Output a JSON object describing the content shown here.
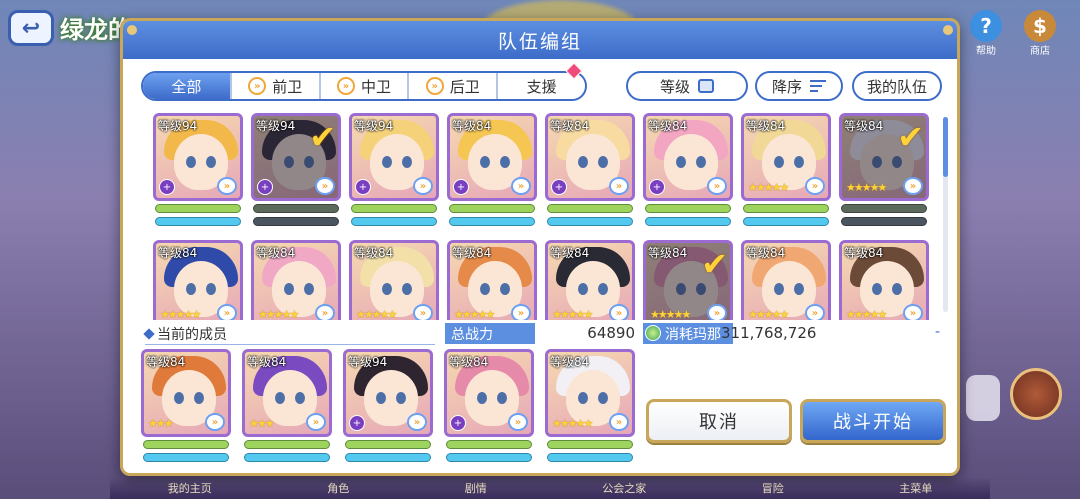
{
  "background": {
    "back_icon": "back-arrow-icon",
    "title": "绿龙的",
    "top_icons": [
      {
        "name": "help",
        "label": "帮助",
        "glyph": "?"
      },
      {
        "name": "guild",
        "label": "商店",
        "glyph": "$"
      }
    ],
    "bottom_menu": [
      "我的主页",
      "角色",
      "剧情",
      "公会之家",
      "冒险",
      "主菜单"
    ]
  },
  "dialog": {
    "title": "队伍编组",
    "tabs": [
      {
        "label": "全部",
        "active": true,
        "icon": ""
      },
      {
        "label": "前卫",
        "active": false,
        "icon": "chevron-icon"
      },
      {
        "label": "中卫",
        "active": false,
        "icon": "chevron-icon"
      },
      {
        "label": "后卫",
        "active": false,
        "icon": "chevron-icon"
      },
      {
        "label": "支援",
        "active": false,
        "icon": ""
      }
    ],
    "sort_field": "等级",
    "sort_order": "降序",
    "my_team": "我的队伍",
    "roster": [
      {
        "level": "等级94",
        "stars": 0,
        "selected": false,
        "hair": "#f2b94a"
      },
      {
        "level": "等级94",
        "stars": 0,
        "selected": true,
        "hair": "#2e2530"
      },
      {
        "level": "等级94",
        "stars": 0,
        "selected": false,
        "hair": "#f5d27a"
      },
      {
        "level": "等级84",
        "stars": 0,
        "selected": false,
        "hair": "#f6c653"
      },
      {
        "level": "等级84",
        "stars": 0,
        "selected": false,
        "hair": "#f7dba0"
      },
      {
        "level": "等级84",
        "stars": 0,
        "selected": false,
        "hair": "#f3a6c2"
      },
      {
        "level": "等级84",
        "stars": 5,
        "selected": false,
        "hair": "#f1d896"
      },
      {
        "level": "等级84",
        "stars": 5,
        "selected": true,
        "hair": "#f2f0f5"
      },
      {
        "level": "等级84",
        "stars": 5,
        "selected": false,
        "hair": "#2f4aa8"
      },
      {
        "level": "等级84",
        "stars": 5,
        "selected": false,
        "hair": "#f0a8c4"
      },
      {
        "level": "等级84",
        "stars": 5,
        "selected": false,
        "hair": "#f2e0a8"
      },
      {
        "level": "等级84",
        "stars": 5,
        "selected": false,
        "hair": "#e68a4a"
      },
      {
        "level": "等级84",
        "stars": 5,
        "selected": false,
        "hair": "#2a2a35"
      },
      {
        "level": "等级84",
        "stars": 5,
        "selected": true,
        "hair": "#e58aa8"
      },
      {
        "level": "等级84",
        "stars": 5,
        "selected": false,
        "hair": "#f0a772"
      },
      {
        "level": "等级84",
        "stars": 5,
        "selected": false,
        "hair": "#6b4a38"
      }
    ],
    "current_members_label": "当前的成员",
    "power_label": "总战力",
    "power_value": "64890",
    "mana_label": "消耗玛那",
    "mana_value": "311,768,726",
    "mana_suffix": "-",
    "team": [
      {
        "level": "等级84",
        "stars": 3,
        "hair": "#e07a3a"
      },
      {
        "level": "等级84",
        "stars": 3,
        "hair": "#7a4ac0"
      },
      {
        "level": "等级94",
        "stars": 0,
        "hair": "#2e2530"
      },
      {
        "level": "等级84",
        "stars": 0,
        "hair": "#e58aa8"
      },
      {
        "level": "等级84",
        "stars": 5,
        "hair": "#f2f0f5"
      }
    ],
    "cancel": "取消",
    "start": "战斗开始"
  },
  "colors": {
    "accent": "#3d6cc9",
    "frame": "#c9a75a",
    "hp": "#9ed35e",
    "tp": "#54c9ef"
  }
}
